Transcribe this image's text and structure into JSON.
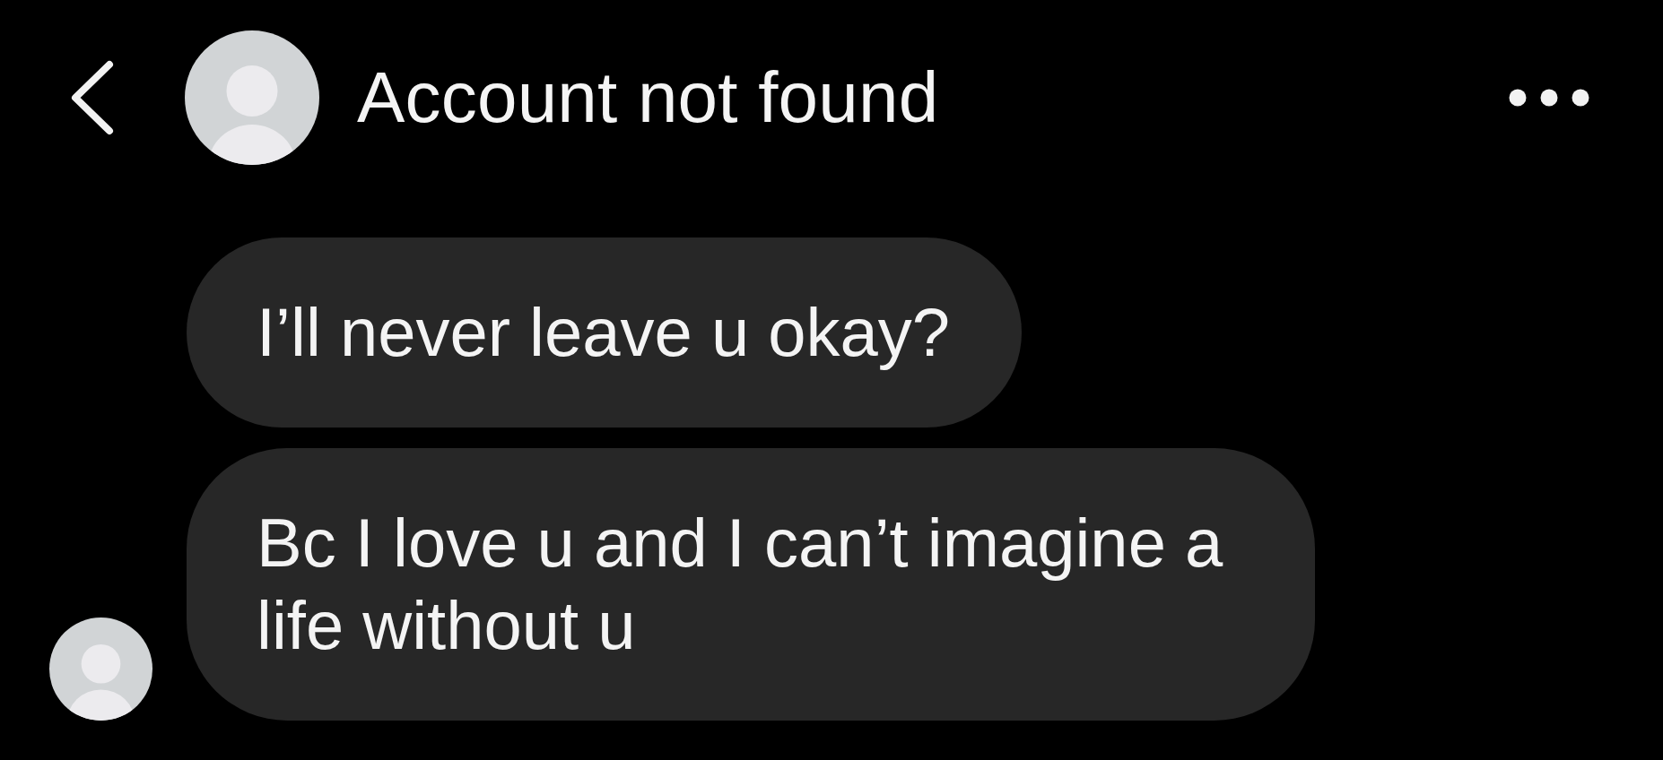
{
  "header": {
    "title": "Account not found"
  },
  "messages": [
    {
      "text": "I’ll never leave u okay?"
    },
    {
      "text": "Bc I love u and I can’t imagine a life without u"
    }
  ]
}
